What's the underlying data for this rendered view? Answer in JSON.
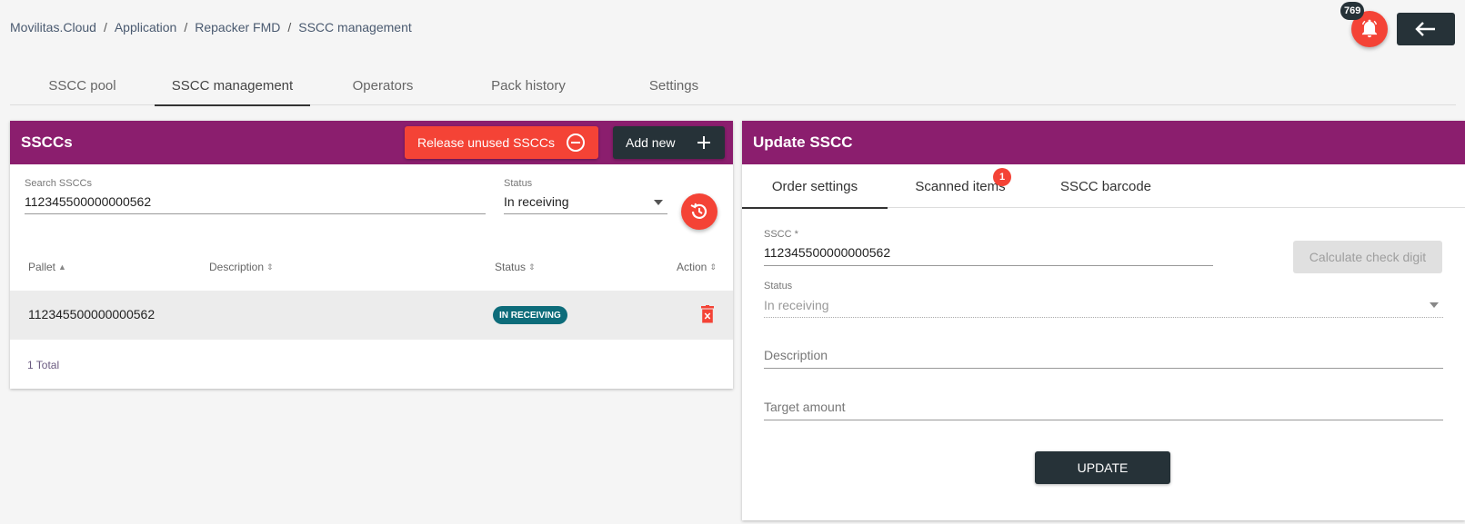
{
  "breadcrumb": [
    "Movilitas.Cloud",
    "Application",
    "Repacker FMD",
    "SSCC management"
  ],
  "breadcrumb_separator": "/",
  "notifications": {
    "count": "769",
    "icon": "bell-icon",
    "accent": "#f44336"
  },
  "back_button": {
    "icon": "arrow-left-icon"
  },
  "main_tabs": [
    {
      "label": "SSCC pool",
      "active": false
    },
    {
      "label": "SSCC management",
      "active": true
    },
    {
      "label": "Operators",
      "active": false
    },
    {
      "label": "Pack history",
      "active": false
    },
    {
      "label": "Settings",
      "active": false
    }
  ],
  "left_panel": {
    "title": "SSCCs",
    "release_button": "Release unused SSCCs",
    "add_button": "Add new",
    "search": {
      "label": "Search SSCCs",
      "value": "112345500000000562"
    },
    "status_filter": {
      "label": "Status",
      "value": "In receiving"
    },
    "table": {
      "columns": [
        "Pallet",
        "Description",
        "Status",
        "Action"
      ],
      "rows": [
        {
          "pallet": "112345500000000562",
          "description": "",
          "status": "IN RECEIVING"
        }
      ],
      "total": "1 Total"
    }
  },
  "right_panel": {
    "title": "Update SSCC",
    "tabs": [
      {
        "label": "Order settings",
        "active": true
      },
      {
        "label": "Scanned items",
        "active": false,
        "badge": "1"
      },
      {
        "label": "SSCC barcode",
        "active": false
      }
    ],
    "sscc": {
      "label": "SSCC *",
      "value": "112345500000000562"
    },
    "calc_button": "Calculate check digit",
    "status": {
      "label": "Status",
      "value": "In receiving"
    },
    "description": {
      "placeholder": "Description"
    },
    "target_amount": {
      "placeholder": "Target amount"
    },
    "update_button": "UPDATE"
  },
  "colors": {
    "header": "#8b1e6e",
    "danger": "#f44336",
    "dark": "#263238",
    "status_badge": "#0d6c7a"
  }
}
